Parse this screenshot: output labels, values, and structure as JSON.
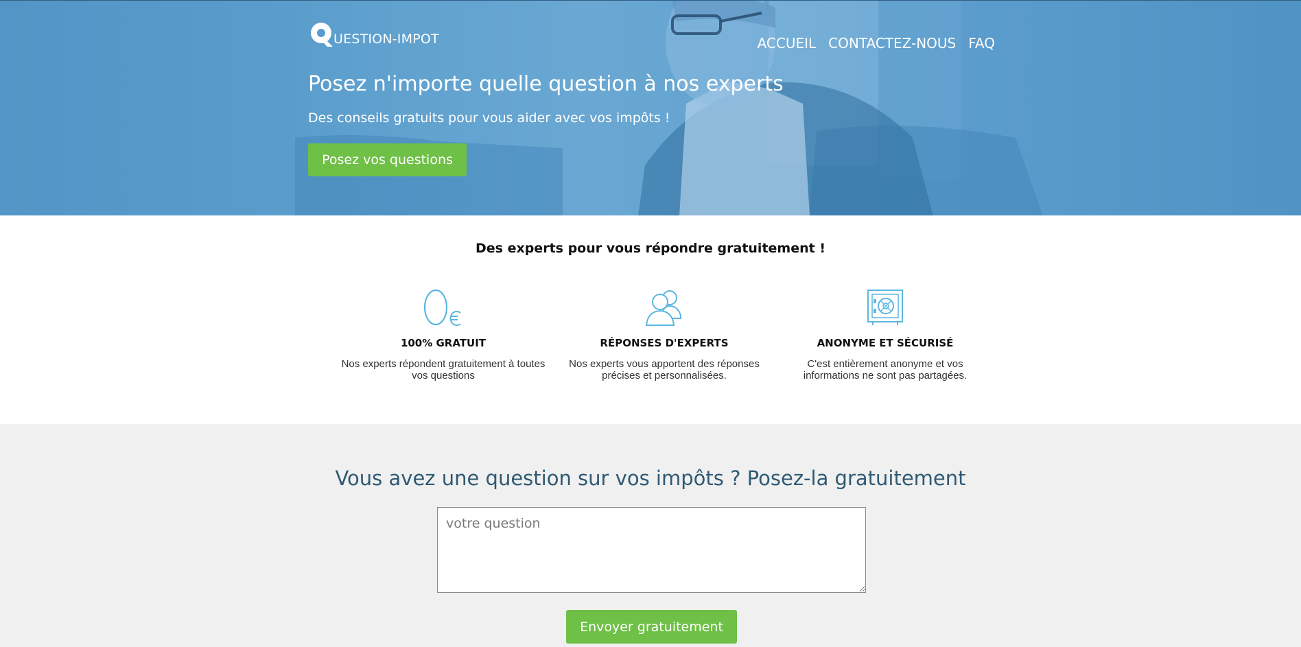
{
  "header": {
    "logo_letter": "Q",
    "logo_text": "UESTION-IMPOT",
    "nav": [
      {
        "label": "ACCUEIL"
      },
      {
        "label": "CONTACTEZ-NOUS"
      },
      {
        "label": "FAQ"
      }
    ]
  },
  "hero": {
    "title": "Posez n'importe quelle question à nos experts",
    "subtitle": "Des conseils gratuits pour vous aider avec vos impôts !",
    "button_label": "Posez vos questions"
  },
  "features": {
    "title": "Des experts pour vous répondre gratuitement !",
    "items": [
      {
        "icon": "zero-euro-icon",
        "heading": "100% GRATUIT",
        "text": "Nos experts répondent gratuitement à toutes vos questions"
      },
      {
        "icon": "experts-icon",
        "heading": "RÉPONSES D'EXPERTS",
        "text": "Nos experts vous apportent des réponses précises et personnalisées."
      },
      {
        "icon": "safe-icon",
        "heading": "ANONYME ET SÉCURISÉ",
        "text": "C'est entièrement anonyme et vos informations ne sont pas partagées."
      }
    ],
    "icon_color": "#5bb6e0"
  },
  "ask": {
    "title": "Vous avez une question sur vos impôts ? Posez-la gratuitement",
    "placeholder": "votre question",
    "button_label": "Envoyer gratuitement"
  },
  "colors": {
    "hero_blue": "#5a9dcc",
    "button_green": "#6ec046",
    "ask_title": "#2f5a73",
    "section_gray": "#f0f0f0"
  }
}
